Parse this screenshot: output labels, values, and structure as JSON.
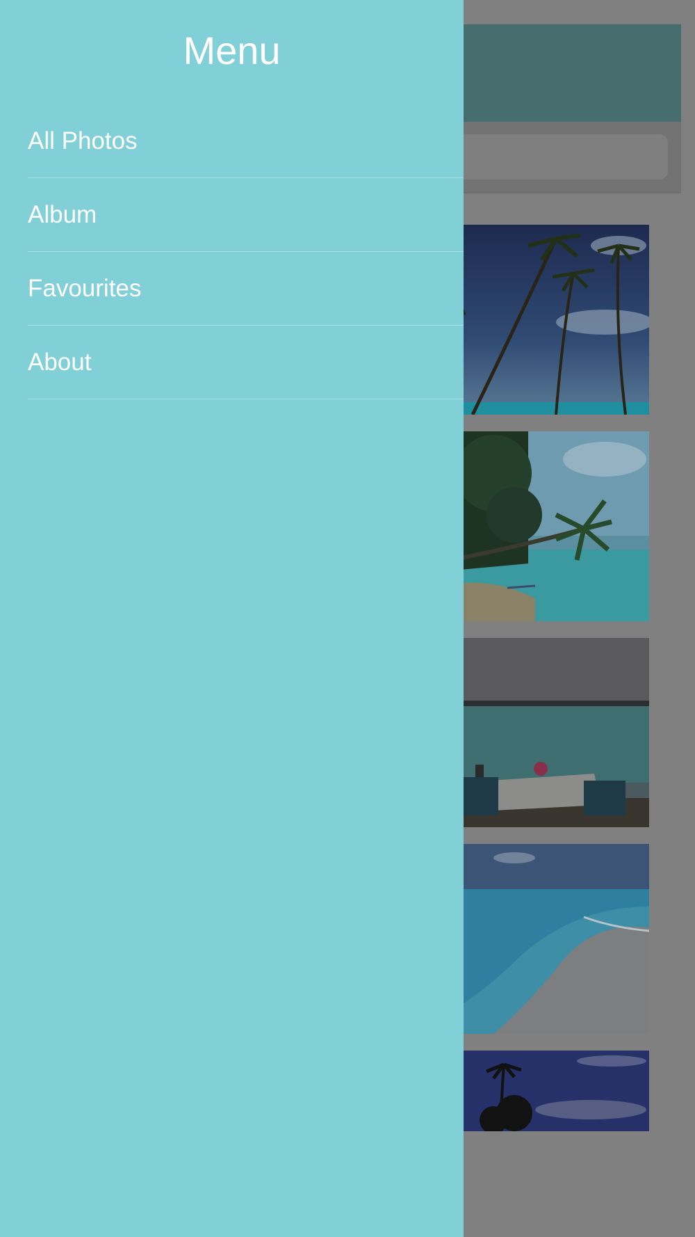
{
  "drawer": {
    "title": "Menu",
    "items": [
      {
        "label": "All Photos"
      },
      {
        "label": "Album"
      },
      {
        "label": "Favourites"
      },
      {
        "label": "About"
      }
    ]
  },
  "colors": {
    "drawer_bg": "#81cfd7",
    "overlay_bg": "#808080",
    "header_bg": "#466e6e"
  }
}
